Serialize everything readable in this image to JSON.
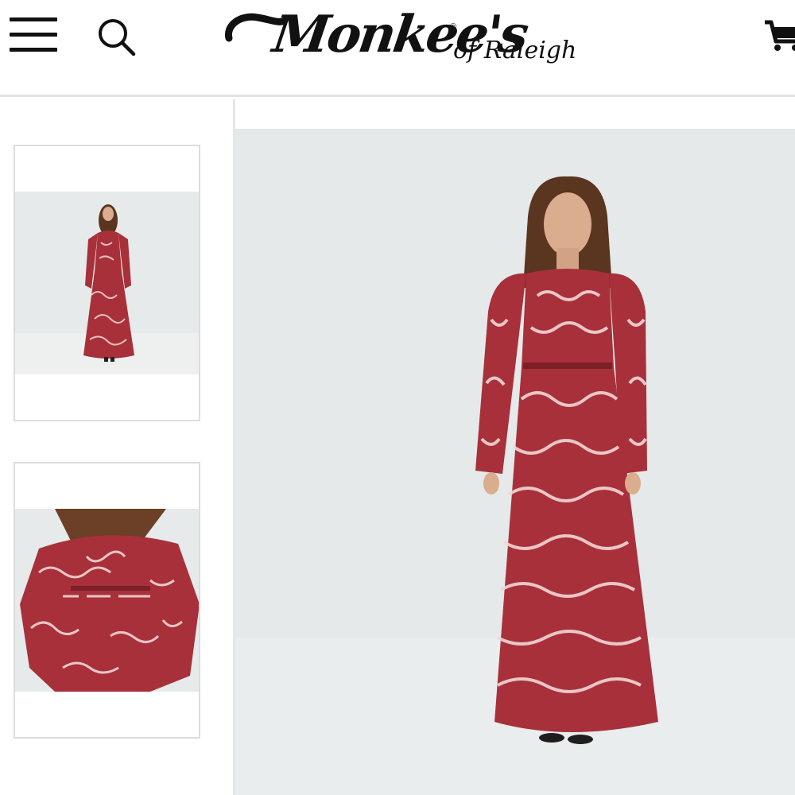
{
  "header": {
    "menu_icon": "hamburger-menu-icon",
    "search_icon": "search-icon",
    "cart_icon": "shopping-cart-icon",
    "logo": {
      "brand": "Monkee's",
      "registered": "®",
      "subtitle": "of Raleigh"
    }
  },
  "gallery": {
    "thumbnails": [
      {
        "view": "full-length-front"
      },
      {
        "view": "bodice-closeup"
      }
    ],
    "main_image": {
      "view": "full-length-front"
    }
  },
  "colors": {
    "dress_base": "#a8303a",
    "dress_pattern": "#f2d7d6",
    "backdrop": "#e5e9e9",
    "hair": "#5a3520",
    "skin": "#d9ad8d",
    "border": "#dcdcdc"
  }
}
